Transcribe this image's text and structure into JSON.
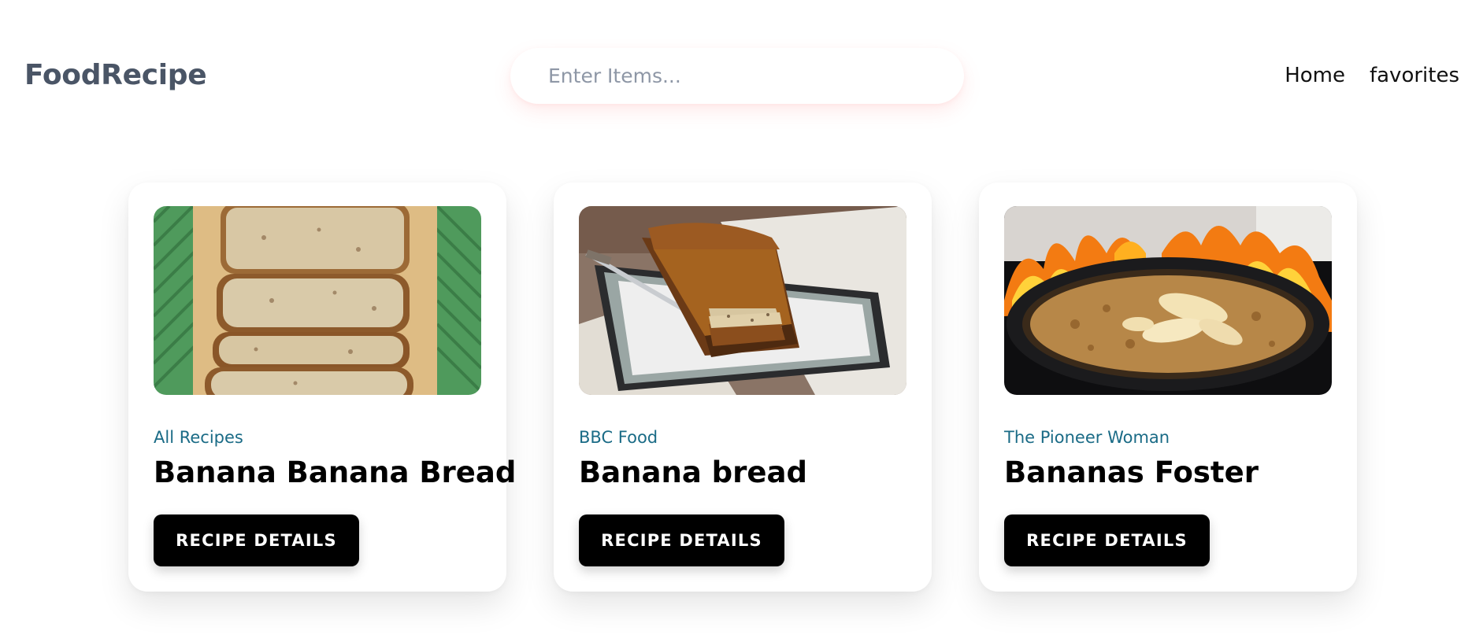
{
  "header": {
    "brand": "FoodRecipe",
    "search": {
      "placeholder": "Enter Items...",
      "value": ""
    },
    "nav": [
      {
        "label": "Home"
      },
      {
        "label": "favorites"
      }
    ]
  },
  "recipes": [
    {
      "source": "All Recipes",
      "title": "Banana Banana Bread",
      "button_label": "RECIPE DETAILS",
      "image": "banana-bread-slices"
    },
    {
      "source": "BBC Food",
      "title": "Banana bread",
      "button_label": "RECIPE DETAILS",
      "image": "banana-bread-loaf"
    },
    {
      "source": "The Pioneer Woman",
      "title": "Bananas Foster",
      "button_label": "RECIPE DETAILS",
      "image": "bananas-foster-flambe"
    }
  ],
  "colors": {
    "brand_text": "#4a5566",
    "source_text": "#1a6b86",
    "button_bg": "#000000",
    "button_text": "#ffffff"
  }
}
